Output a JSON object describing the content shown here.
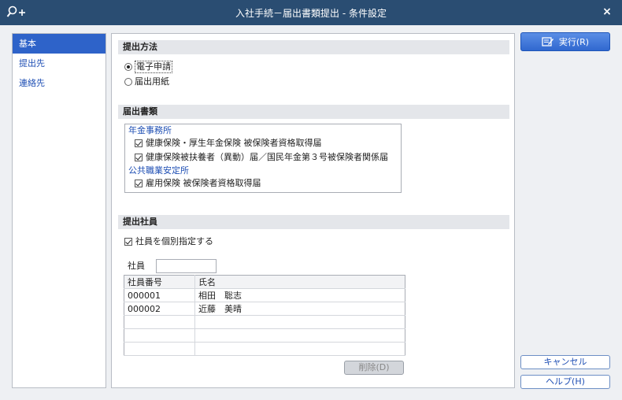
{
  "window": {
    "title": "入社手続－届出書類提出 - 条件設定",
    "close_glyph": "×",
    "icon": "search-plus-icon"
  },
  "sidebar": {
    "items": [
      {
        "label": "基本"
      },
      {
        "label": "提出先"
      },
      {
        "label": "連絡先"
      }
    ]
  },
  "submission_method": {
    "header": "提出方法",
    "options": [
      {
        "label": "電子申請",
        "selected": true
      },
      {
        "label": "届出用紙",
        "selected": false
      }
    ]
  },
  "documents": {
    "header": "届出書類",
    "groups": [
      {
        "name": "年金事務所",
        "items": [
          {
            "label": "健康保険・厚生年金保険 被保険者資格取得届",
            "checked": true
          },
          {
            "label": "健康保険被扶養者（異動）届／国民年金第３号被保険者関係届",
            "checked": true
          }
        ]
      },
      {
        "name": "公共職業安定所",
        "items": [
          {
            "label": "雇用保険 被保険者資格取得届",
            "checked": true
          }
        ]
      }
    ]
  },
  "employees": {
    "header": "提出社員",
    "individual_checkbox": {
      "label": "社員を個別指定する",
      "checked": true
    },
    "employee_label": "社員",
    "employee_value": "",
    "columns": [
      "社員番号",
      "氏名"
    ],
    "rows": [
      {
        "id": "000001",
        "name": "相田　聡志"
      },
      {
        "id": "000002",
        "name": "近藤　美晴"
      }
    ],
    "delete_label": "削除(D)"
  },
  "buttons": {
    "execute": "実行(R)",
    "cancel": "キャンセル",
    "help": "ヘルプ(H)"
  },
  "colors": {
    "titlebar": "#2a4d72",
    "accent": "#2e63c9",
    "link": "#1f4fb4"
  }
}
